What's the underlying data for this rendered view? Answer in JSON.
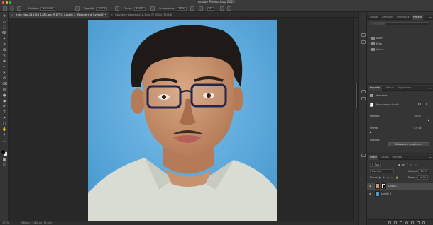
{
  "app": {
    "title": "Adobe Photoshop 2022"
  },
  "options_bar": {
    "mode_label": "Metodo:",
    "mode_value": "Normale",
    "opacity_label": "Opacità:",
    "opacity_value": "100%",
    "flow_label": "Flusso:",
    "flow_value": "100%",
    "smoothing_label": "Smussatura:",
    "smoothing_value": "10%",
    "angle_value": "0°"
  },
  "tabs": [
    {
      "label": "from-view-216183_1280.jpg @ 175% (Livello 1, Maschera di livello/8) *",
      "active": true
    },
    {
      "label": "Salvatore_Aranzulla_2-1.jpg @ 100% (RGB/8)",
      "active": false
    }
  ],
  "status": {
    "zoom": "175%",
    "doc_info": "980 px x 1080 px (72 ppi)"
  },
  "swatches_panel": {
    "tabs": [
      "Colore",
      "Campioni",
      "Sfumature",
      "Pattern"
    ],
    "active_tab": "Pattern",
    "search_placeholder": "Cerca pattern",
    "folders": [
      "Alberi",
      "Erba",
      "Acqua"
    ]
  },
  "properties_panel": {
    "tabs": [
      "Proprietà",
      "Librerie",
      "Regolazioni"
    ],
    "active_tab": "Proprietà",
    "section_title": "Maschere",
    "mask_type": "Maschera di livello",
    "density_label": "Densità:",
    "density_value": "100%",
    "feather_label": "Sfuma:",
    "feather_value": "0,0 px",
    "refine_label": "Migliora:",
    "select_mask_button": "Seleziona e maschera..."
  },
  "layers_panel": {
    "tabs": [
      "Livelli",
      "Canali",
      "Tracciati"
    ],
    "active_tab": "Livelli",
    "filter_kind": "Tipo",
    "blend_mode": "Normale",
    "opacity_label": "Opacità:",
    "opacity_value": "100%",
    "lock_label": "Blocca:",
    "fill_label": "Riemp.:",
    "fill_value": "100%",
    "layers": [
      {
        "name": "Livello 1",
        "selected": true,
        "has_mask": true
      },
      {
        "name": "Livello 0",
        "selected": false,
        "has_mask": false
      }
    ]
  },
  "colors": {
    "accent": "#2d8ceb",
    "photo_background": "#5ba9d9"
  },
  "icons": {
    "toolbar": [
      "move-icon",
      "artboard-icon",
      "marquee-icon",
      "lasso-icon",
      "quick-select-icon",
      "crop-icon",
      "frame-icon",
      "eyedropper-icon",
      "healing-brush-icon",
      "brush-icon",
      "clone-stamp-icon",
      "history-brush-icon",
      "eraser-icon",
      "gradient-icon",
      "blur-icon",
      "dodge-icon",
      "pen-icon",
      "text-icon",
      "path-select-icon",
      "rectangle-icon",
      "hand-icon",
      "zoom-icon",
      "more-tools-icon"
    ]
  }
}
